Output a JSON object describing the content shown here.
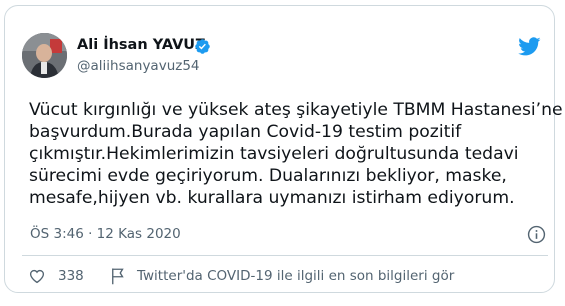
{
  "tweet": {
    "author_name": "Ali İhsan YAVUZ",
    "handle": "@aliihsanyavuz54",
    "text_lines": [
      "Vücut kırgınlığı ve yüksek ateş şikayetiyle TBMM Hastanesi’ne",
      "başvurdum.Burada yapılan Covid-19 testim pozitif",
      "çıkmıştır.Hekimlerimizin tavsiyeleri doğrultusunda tedavi",
      "sürecimi evde geçiriyorum. Dualarınızı bekliyor, maske,",
      "mesafe,hijyen vb. kurallara uymanızı istirham ediyorum."
    ],
    "timestamp": "ÖS 3:46 · 12 Kas 2020",
    "likes": "338",
    "covid_notice": "Twitter'da COVID-19 ile ilgili en son bilgileri gör"
  },
  "icons": {
    "verified": "verified-badge-icon",
    "brand": "twitter-bird-icon",
    "info": "info-icon",
    "like": "heart-icon",
    "notice": "flag-icon"
  },
  "colors": {
    "brand": "#1d9bf0",
    "text": "#0f1419",
    "secondary": "#536471",
    "border": "#cfd9de"
  }
}
